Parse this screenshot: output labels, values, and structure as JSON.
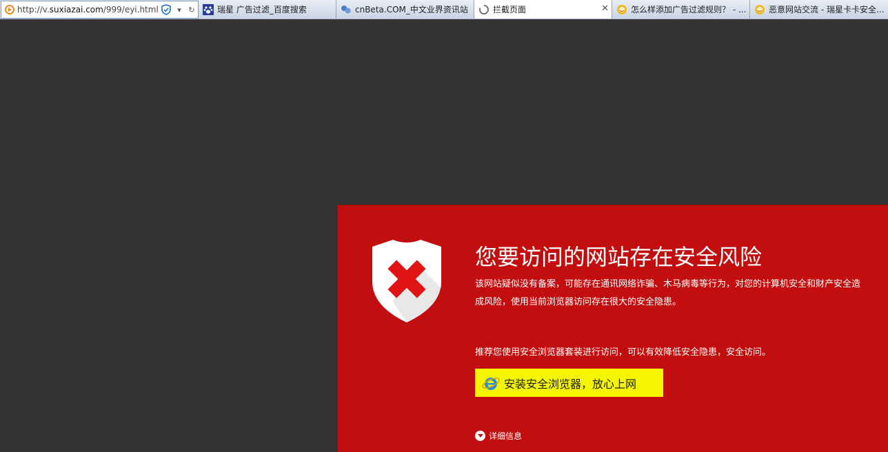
{
  "address_bar": {
    "url_prefix": "http://v.",
    "url_domain": "suxiazai.com",
    "url_suffix": "/999/eyi.html?!"
  },
  "tabs": [
    {
      "label": "瑞星 广告过滤_百度搜索",
      "icon": "baidu-paw-icon",
      "active": false
    },
    {
      "label": "cnBeta.COM_中文业界资讯站",
      "icon": "cnbeta-icon",
      "active": false
    },
    {
      "label": "拦截页面",
      "icon": "loading-icon",
      "active": true,
      "close": "✕"
    },
    {
      "label": "怎么样添加广告过滤规则？ - ...",
      "icon": "rising-lion-icon",
      "active": false
    },
    {
      "label": "恶意网站交流 - 瑞星卡卡安全...",
      "icon": "rising-lion-icon",
      "active": false
    }
  ],
  "warning": {
    "title": "您要访问的网站存在安全风险",
    "description": "该网站疑似没有备案，可能存在通讯网络诈骗、木马病毒等行为，对您的计算机安全和财产安全造成风险，使用当前浏览器访问存在很大的安全隐患。",
    "recommend": "推荐您使用安全浏览器套装进行访问，可以有效降低安全隐患，安全访问。",
    "install_button": "安装安全浏览器，放心上网",
    "details_link": "详细信息"
  },
  "colors": {
    "background": "#333333",
    "panel": "#c20e0e",
    "button": "#f5f500"
  }
}
